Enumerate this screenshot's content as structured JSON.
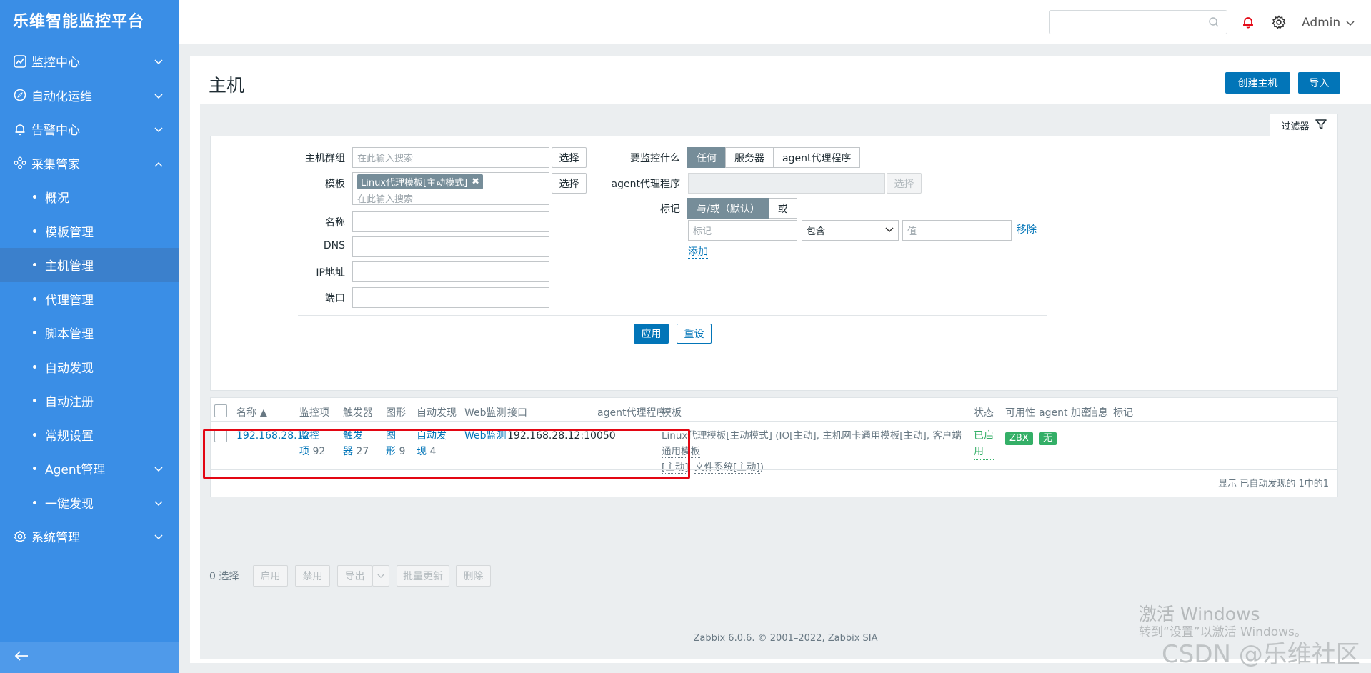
{
  "brand": "乐维智能监控平台",
  "sidebar": {
    "items": [
      {
        "label": "监控中心"
      },
      {
        "label": "自动化运维"
      },
      {
        "label": "告警中心"
      },
      {
        "label": "采集管家"
      },
      {
        "label": "概况"
      },
      {
        "label": "模板管理"
      },
      {
        "label": "主机管理"
      },
      {
        "label": "代理管理"
      },
      {
        "label": "脚本管理"
      },
      {
        "label": "自动发现"
      },
      {
        "label": "自动注册"
      },
      {
        "label": "常规设置"
      },
      {
        "label": "Agent管理"
      },
      {
        "label": "一键发现"
      },
      {
        "label": "系统管理"
      }
    ]
  },
  "topbar": {
    "user": "Admin",
    "search_placeholder": ""
  },
  "page": {
    "title": "主机",
    "create_label": "创建主机",
    "import_label": "导入"
  },
  "filter": {
    "tab_label": "过滤器",
    "hostgroup_label": "主机群组",
    "hostgroup_placeholder": "在此输入搜索",
    "select_label": "选择",
    "template_label": "模板",
    "template_tag": "Linux代理模板[主动模式]",
    "template_placeholder": "在此输入搜索",
    "name_label": "名称",
    "dns_label": "DNS",
    "ip_label": "IP地址",
    "port_label": "端口",
    "monitored_label": "要监控什么",
    "monitored_options": [
      "任何",
      "服务器",
      "agent代理程序"
    ],
    "proxy_label": "agent代理程序",
    "tags_label": "标记",
    "tags_options": [
      "与/或（默认）",
      "或"
    ],
    "tag_placeholder": "标记",
    "tag_operator": "包含",
    "value_placeholder": "值",
    "remove_label": "移除",
    "add_label": "添加",
    "apply_label": "应用",
    "reset_label": "重设"
  },
  "table": {
    "headers": [
      "名称 ▲",
      "监控项",
      "触发器",
      "图形",
      "自动发现",
      "Web监测",
      "接口",
      "agent代理程序",
      "模板",
      "状态",
      "可用性",
      "agent 加密",
      "信息",
      "标记"
    ],
    "rows": [
      {
        "name": "192.168.28.12",
        "items_a": "监控",
        "items_b": "项",
        "items_count": "92",
        "triggers_a": "触发",
        "triggers_b": "器",
        "triggers_count": "27",
        "graphs_a": "图",
        "graphs_b": "形",
        "graphs_count": "9",
        "discovery_a": "自动发",
        "discovery_b": "现",
        "discovery_count": "4",
        "web": "Web监测",
        "interface": "192.168.28.12:10050",
        "template_main": "Linux代理模板[主动模式]",
        "template_open": " (",
        "template_sub1": "IO[主动]",
        "template_sep1": ", ",
        "template_sub2": "主机网卡通用模板[主动]",
        "template_sep2": ", ",
        "template_sub3": "客户端通用模板",
        "template_sub3b": "[主动]",
        "template_sep3": ", ",
        "template_sub4": "文件系统[主动]",
        "template_close": ")",
        "status_a": "已启",
        "status_b": "用",
        "availability": "ZBX",
        "encryption": "无"
      }
    ],
    "summary": "显示 已自动发现的 1中的1"
  },
  "actions": {
    "selected": "0 选择",
    "enable": "启用",
    "disable": "禁用",
    "export": "导出",
    "mass_update": "批量更新",
    "delete": "删除"
  },
  "footer": {
    "text": "Zabbix 6.0.6. © 2001–2022, ",
    "company": "Zabbix SIA"
  },
  "watermark": {
    "line1": "激活 Windows",
    "line2": "转到“设置”以激活 Windows。",
    "line3": "CSDN @乐维社区"
  },
  "colors": {
    "sidebar": "#3a8ee6",
    "primary": "#0275b8",
    "ok": "#34af67",
    "highlight": "#e30613"
  }
}
